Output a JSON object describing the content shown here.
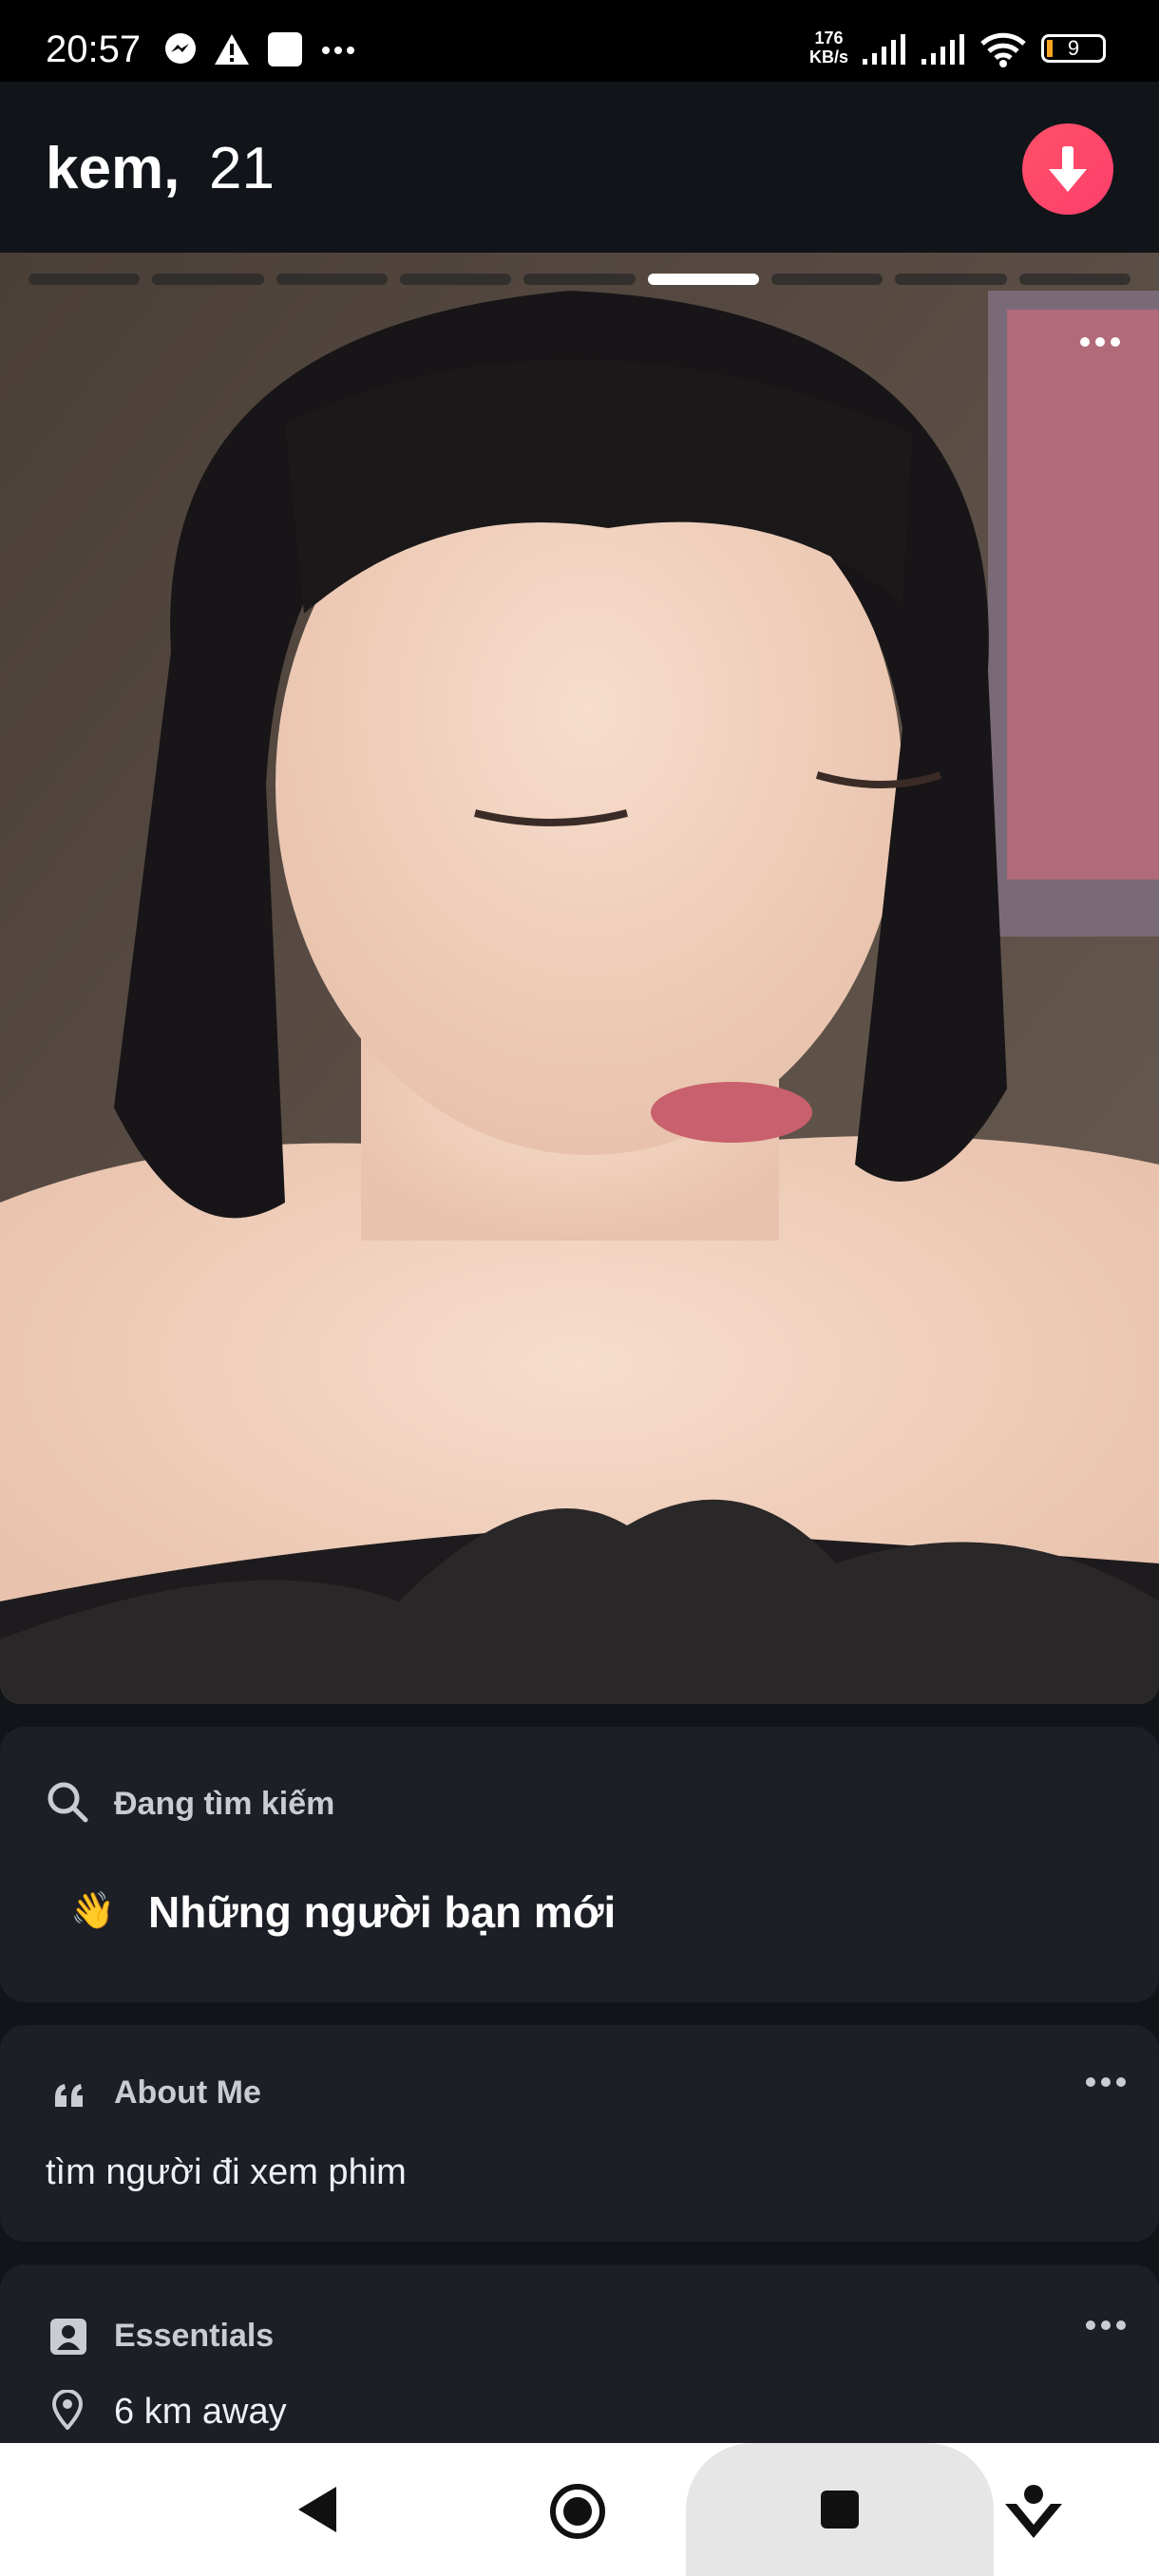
{
  "status_bar": {
    "time": "20:57",
    "speed_value": "176",
    "speed_unit": "KB/s",
    "battery": "9",
    "icons": [
      "messenger-icon",
      "warning-icon",
      "app-square-icon",
      "more-dots-icon",
      "signal-icon",
      "signal-icon",
      "wifi-icon",
      "battery-icon"
    ]
  },
  "profile": {
    "name": "kem,",
    "age": "21",
    "photo_count": 9,
    "active_photo": 6
  },
  "looking_for": {
    "label": "Đang tìm kiếm",
    "emoji": "👋",
    "value": "Những người bạn mới"
  },
  "about": {
    "label": "About Me",
    "text": "tìm người đi xem phim"
  },
  "essentials": {
    "label": "Essentials",
    "distance": "6 km away"
  },
  "colors": {
    "background": "#111419",
    "card": "#1c1f26",
    "accent": "#fd5068"
  }
}
